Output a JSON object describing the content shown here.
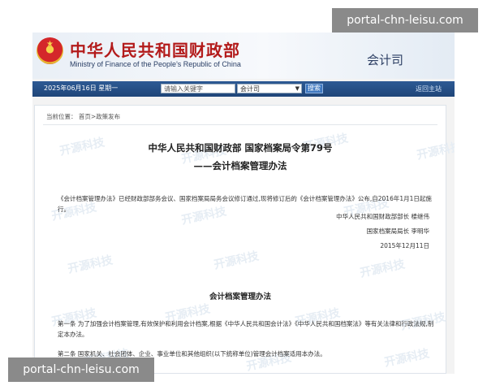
{
  "header": {
    "title_cn": "中华人民共和国财政部",
    "title_en": "Ministry of Finance of the People's Republic of China",
    "department": "会计司"
  },
  "navbar": {
    "date": "2025年06月16日  星期一",
    "search_placeholder": "请输入关键字",
    "select_value": "会计司",
    "search_button": "搜索",
    "home_link": "返回主站"
  },
  "breadcrumb": "当前位置：  首页>政策发布",
  "document": {
    "title_line1": "中华人民共和国财政部  国家档案局令第79号",
    "title_line2": "——会计档案管理办法",
    "intro": "《会计档案管理办法》已经财政部部务会议、国家档案局局务会议修订通过,现将修订后的《会计档案管理办法》公布,自2016年1月1日起施行。",
    "signatory1": "中华人民共和国财政部部长  楼继伟",
    "signatory2": "国家档案局局长  李明华",
    "sign_date": "2015年12月11日",
    "section_title": "会计档案管理办法",
    "article1": "第一条  为了加强会计档案管理,有效保护和利用会计档案,根据《中华人民共和国会计法》《中华人民共和国档案法》等有关法律和行政法规,制定本办法。",
    "article2": "第二条  国家机关、社会团体、企业、事业单位和其他组织(以下统称单位)管理会计档案适用本办法。"
  },
  "watermark_text": "开源科技",
  "overlays": {
    "top_right": "portal-chn-leisu.com",
    "bottom_left": "portal-chn-leisu.com"
  }
}
